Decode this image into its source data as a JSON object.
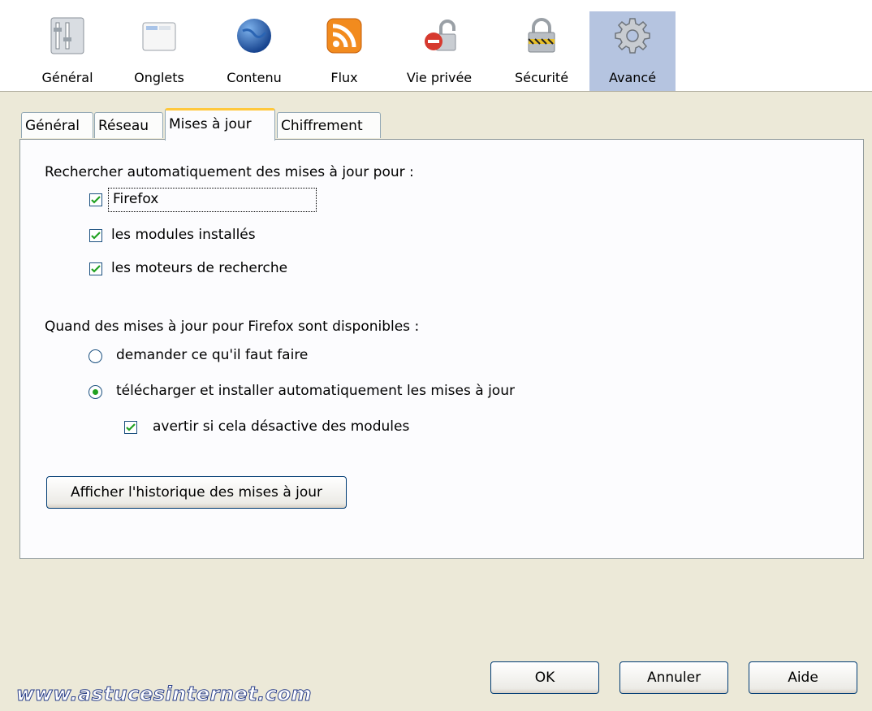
{
  "toolbar": {
    "panes": [
      {
        "label": "Général",
        "icon": "general-icon"
      },
      {
        "label": "Onglets",
        "icon": "tabs-icon"
      },
      {
        "label": "Contenu",
        "icon": "globe-icon"
      },
      {
        "label": "Flux",
        "icon": "rss-icon"
      },
      {
        "label": "Vie privée",
        "icon": "privacy-icon"
      },
      {
        "label": "Sécurité",
        "icon": "padlock-icon"
      },
      {
        "label": "Avancé",
        "icon": "gear-icon",
        "selected": true
      }
    ]
  },
  "tabs": [
    {
      "label": "Général"
    },
    {
      "label": "Réseau"
    },
    {
      "label": "Mises à jour",
      "active": true
    },
    {
      "label": "Chiffrement"
    }
  ],
  "updates": {
    "auto_check_heading": "Rechercher automatiquement des mises à jour pour :",
    "check_items": [
      {
        "label": "Firefox",
        "checked": true
      },
      {
        "label": "les modules installés",
        "checked": true
      },
      {
        "label": "les moteurs de recherche",
        "checked": true
      }
    ],
    "when_heading": "Quand des mises à jour pour Firefox sont disponibles :",
    "radio_items": [
      {
        "label": "demander ce qu'il faut faire",
        "selected": false
      },
      {
        "label": "télécharger et installer automatiquement les mises à jour",
        "selected": true
      }
    ],
    "warn_item": {
      "label": "avertir si cela désactive des modules",
      "checked": true
    },
    "history_button": "Afficher l'historique des mises à jour"
  },
  "buttons": {
    "ok": "OK",
    "cancel": "Annuler",
    "help": "Aide"
  },
  "watermark": "www.astucesinternet.com",
  "colors": {
    "selected_pane": "#b5c4e0",
    "active_tab_accent": "#ffc83c",
    "check": "#21a121"
  }
}
